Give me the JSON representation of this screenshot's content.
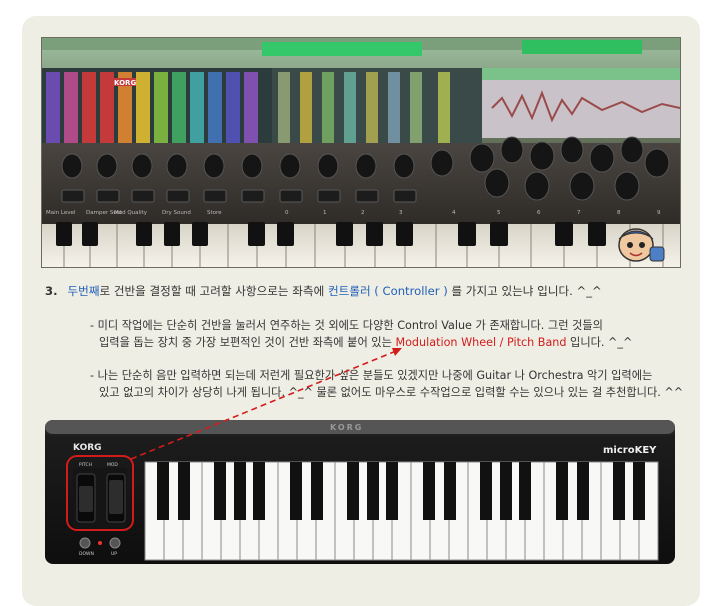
{
  "section": {
    "number": "3.",
    "highlight_1": "두번째",
    "text_1": "로 건반을 결정할 때 고려할 사항으로는 좌측에 ",
    "highlight_2": "컨트롤러 ( Controller )",
    "text_2": " 를 가지고 있는냐 입니다. ^_^"
  },
  "bullet_1": {
    "line1": "- 미디 작업에는 단순히 건반을 눌러서 연주하는 것 외에도 다양한 Control Value 가 존재합니다. 그런 것들의",
    "line2_pre": "입력을 돕는 장치 중 가장 보편적인 것이 건반 좌측에 붙어 있는 ",
    "line2_highlight": "Modulation Wheel / Pitch Band",
    "line2_post": " 입니다. ^_^"
  },
  "bullet_2": {
    "line1": "- 나는 단순히 음만 입력하면 되는데 저런게 필요한가 싶은 분들도 있겠지만 나중에 Guitar 나 Orchestra 악기 입력에는",
    "line2": "있고 없고의 차이가 상당히 나게 됩니다. ^_^ 물론 없어도 마우스로 수작업으로 입력할 수는 있으나 있는 걸 추천합니다. ^^"
  },
  "keyboard": {
    "brand": "KORG",
    "model": "microKEY",
    "wheel_label_1": "PITCH",
    "wheel_label_2": "MOD",
    "button_down": "DOWN",
    "button_up": "UP",
    "back_brand": "KORG"
  },
  "photo": {
    "brand": "KORG",
    "knob_labels": [
      "0",
      "1",
      "2",
      "3",
      "4",
      "5",
      "6",
      "7",
      "8",
      "9"
    ],
    "left_labels": [
      "Main Level",
      "Damper Sust",
      "Mod Quality",
      "Dry Sound",
      "Store"
    ]
  },
  "colors": {
    "highlight_blue": "#1f5fb8",
    "highlight_red": "#d21c1c",
    "card_bg": "#efeee4"
  }
}
